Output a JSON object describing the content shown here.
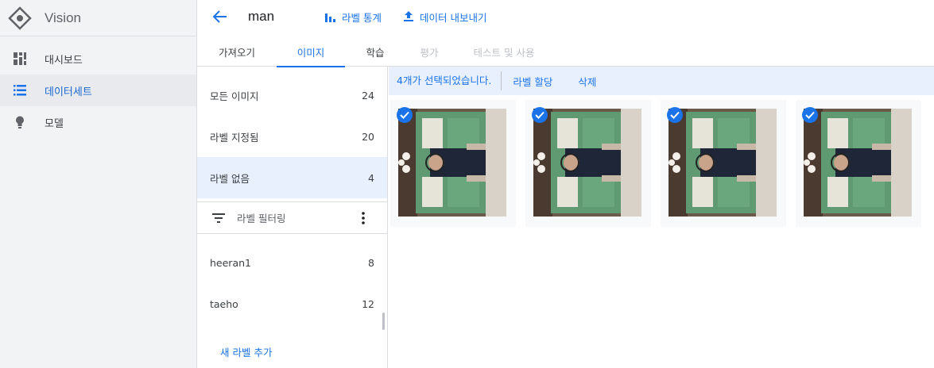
{
  "app": {
    "name": "Vision",
    "nav": [
      {
        "label": "대시보드",
        "icon": "dashboard-icon"
      },
      {
        "label": "데이터세트",
        "icon": "list-icon"
      },
      {
        "label": "모델",
        "icon": "lightbulb-icon"
      }
    ]
  },
  "dataset": {
    "name": "man",
    "actions": [
      {
        "label": "라벨 통계",
        "icon": "bar-chart-icon"
      },
      {
        "label": "데이터 내보내기",
        "icon": "upload-icon"
      }
    ]
  },
  "tabs": [
    "가져오기",
    "이미지",
    "학습",
    "평가",
    "테스트 및 사용"
  ],
  "filters": {
    "items": [
      {
        "label": "모든 이미지",
        "count": "24"
      },
      {
        "label": "라벨 지정됨",
        "count": "20"
      },
      {
        "label": "라벨 없음",
        "count": "4"
      }
    ],
    "label_filter": "라벨 필터링",
    "labels": [
      {
        "label": "heeran1",
        "count": "8"
      },
      {
        "label": "taeho",
        "count": "12"
      }
    ],
    "add_label": "새 라벨 추가"
  },
  "selection": {
    "count_text": "4개가 선택되었습니다.",
    "assign_label": "라벨 할당",
    "delete": "삭제"
  },
  "colors": {
    "accent": "#1a73e8",
    "selected_bg": "#e8f0fe",
    "nav_bg": "#f1f3f4"
  },
  "images": [
    {
      "selected": true
    },
    {
      "selected": true
    },
    {
      "selected": true
    },
    {
      "selected": true
    }
  ]
}
